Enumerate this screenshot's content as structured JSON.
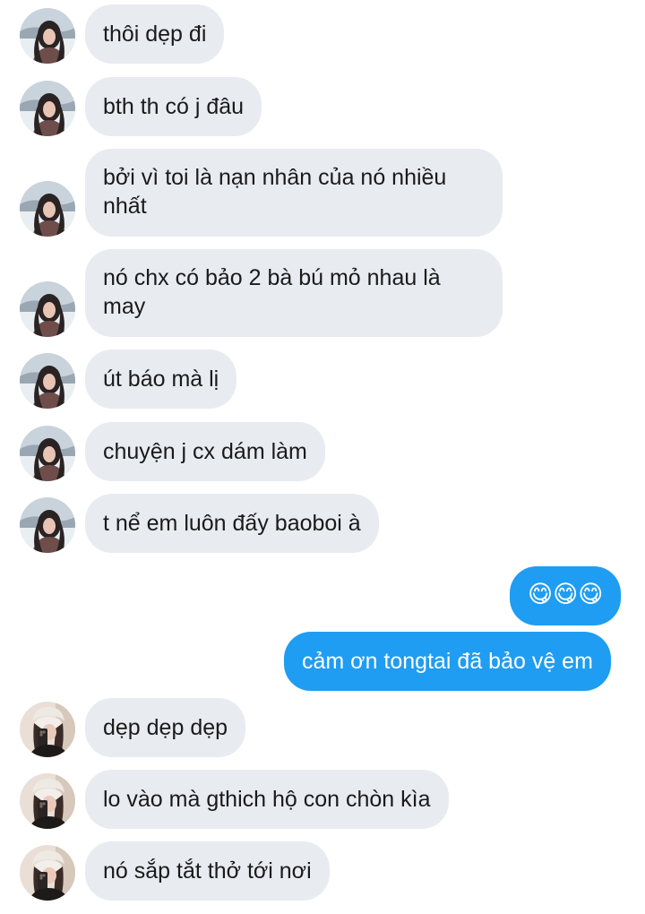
{
  "messages": [
    {
      "text": "thôi dẹp đi"
    },
    {
      "text": "bth th có j đâu"
    },
    {
      "text": "bởi vì toi là nạn nhân của nó nhiều nhất"
    },
    {
      "text": "nó chx có bảo 2 bà bú mỏ nhau là may"
    },
    {
      "text": "út báo mà lị"
    },
    {
      "text": "chuyện j cx dám làm"
    },
    {
      "text": "t nể em luôn đấy baoboi à"
    },
    {
      "text": "😋😋😋"
    },
    {
      "text": "cảm ơn tongtai đã bảo vệ em"
    },
    {
      "text": "dẹp dẹp dẹp"
    },
    {
      "text": "lo vào mà gthich hộ con chòn kìa"
    },
    {
      "text": "nó sắp tắt thở tới nơi"
    }
  ],
  "colors": {
    "incoming_bubble": "#e8ecf1",
    "outgoing_bubble": "#1e9df2",
    "incoming_text": "#1a1a1a",
    "outgoing_text": "#ffffff"
  },
  "icons": {
    "avatar_a": "profile-photo-girl-snow",
    "avatar_b": "profile-photo-girl-mirror-selfie"
  }
}
